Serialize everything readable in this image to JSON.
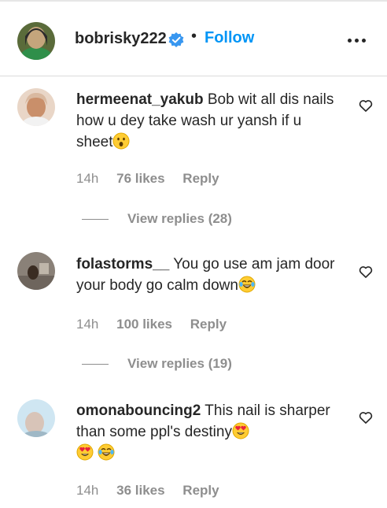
{
  "header": {
    "username": "bobrisky222",
    "verified": true,
    "separator": "•",
    "follow_label": "Follow",
    "more_icon": "more-horizontal-icon"
  },
  "comments": [
    {
      "username": "hermeenat_yakub",
      "text": "Bob wit all dis nails how u dey take wash ur yansh if u sheet",
      "emojis": [
        "hushed-face-emoji"
      ],
      "time": "14h",
      "likes": "76 likes",
      "reply_label": "Reply",
      "view_replies": "View replies (28)"
    },
    {
      "username": "folastorms__",
      "text": "You go use am jam door your body go calm down",
      "emojis": [
        "face-with-tears-of-joy-emoji"
      ],
      "time": "14h",
      "likes": "100 likes",
      "reply_label": "Reply",
      "view_replies": "View replies (19)"
    },
    {
      "username": "omonabouncing2",
      "text": "This nail is sharper than some ppl's destiny",
      "emojis": [
        "heart-eyes-emoji",
        "heart-eyes-emoji",
        "face-with-tears-of-joy-emoji"
      ],
      "time": "14h",
      "likes": "36 likes",
      "reply_label": "Reply"
    }
  ],
  "colors": {
    "text": "#262626",
    "muted": "#8e8e8e",
    "follow": "#0095f6",
    "verified": "#3897f0",
    "divider": "#dbdbdb"
  }
}
